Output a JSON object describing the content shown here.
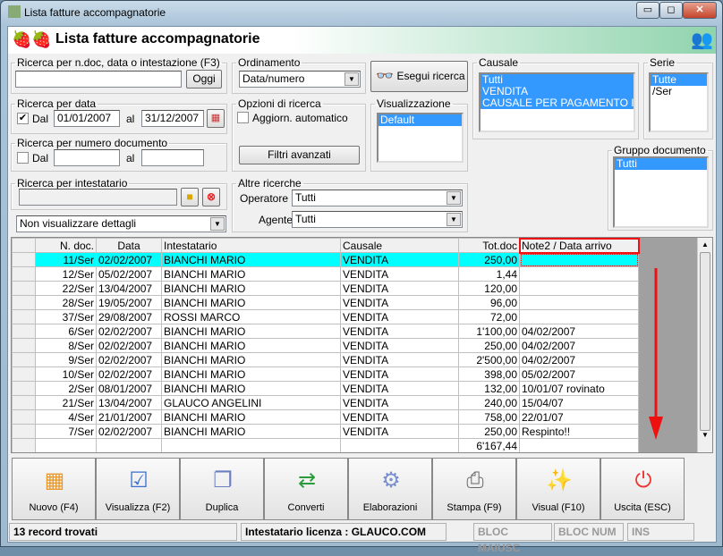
{
  "window": {
    "title": "Lista fatture accompagnatorie",
    "minimize": "▭",
    "maximize": "◻",
    "close": "✕"
  },
  "header": {
    "title": "Lista fatture accompagnatorie"
  },
  "search_text": {
    "legend": "Ricerca per n.doc, data o intestazione (F3)",
    "value": "",
    "today_button": "Oggi"
  },
  "ordering": {
    "legend": "Ordinamento",
    "value": "Data/numero"
  },
  "execute_button": "Esegui ricerca",
  "causale": {
    "legend": "Causale",
    "items": [
      "Tutti",
      "VENDITA",
      "CAUSALE PER PAGAMENTO IN C"
    ]
  },
  "serie": {
    "legend": "Serie",
    "items": [
      "Tutte",
      "/Ser"
    ]
  },
  "date_search": {
    "legend": "Ricerca per data",
    "checked": true,
    "from_label": "Dal",
    "from": "01/01/2007",
    "to_label": "al",
    "to": "31/12/2007"
  },
  "options": {
    "legend": "Opzioni di ricerca",
    "auto_update": "Aggiorn. automatico",
    "advanced_filters": "Filtri avanzati"
  },
  "view": {
    "legend": "Visualizzazione",
    "items": [
      "Default"
    ]
  },
  "doc_number": {
    "legend": "Ricerca per numero documento",
    "from_label": "Dal",
    "to_label": "al",
    "from": "",
    "to": ""
  },
  "gruppo": {
    "legend": "Gruppo documento",
    "items": [
      "Tutti"
    ]
  },
  "holder": {
    "legend": "Ricerca per intestatario",
    "value": ""
  },
  "other": {
    "legend": "Altre ricerche",
    "operator_label": "Operatore :",
    "operator": "Tutti",
    "agent_label": "Agente :",
    "agent": "Tutti"
  },
  "details": {
    "value": "Non visualizzare dettagli"
  },
  "grid": {
    "columns": [
      "N. doc.",
      "Data",
      "Intestatario",
      "Causale",
      "Tot.doc",
      "Note2 / Data arrivo"
    ],
    "rows": [
      [
        "11/Ser",
        "02/02/2007",
        "BIANCHI MARIO",
        "VENDITA",
        "250,00",
        ""
      ],
      [
        "12/Ser",
        "05/02/2007",
        "BIANCHI MARIO",
        "VENDITA",
        "1,44",
        ""
      ],
      [
        "22/Ser",
        "13/04/2007",
        "BIANCHI MARIO",
        "VENDITA",
        "120,00",
        ""
      ],
      [
        "28/Ser",
        "19/05/2007",
        "BIANCHI MARIO",
        "VENDITA",
        "96,00",
        ""
      ],
      [
        "37/Ser",
        "29/08/2007",
        "ROSSI MARCO",
        "VENDITA",
        "72,00",
        ""
      ],
      [
        "6/Ser",
        "02/02/2007",
        "BIANCHI MARIO",
        "VENDITA",
        "1'100,00",
        "04/02/2007"
      ],
      [
        "8/Ser",
        "02/02/2007",
        "BIANCHI MARIO",
        "VENDITA",
        "250,00",
        "04/02/2007"
      ],
      [
        "9/Ser",
        "02/02/2007",
        "BIANCHI MARIO",
        "VENDITA",
        "2'500,00",
        "04/02/2007"
      ],
      [
        "10/Ser",
        "02/02/2007",
        "BIANCHI MARIO",
        "VENDITA",
        "398,00",
        "05/02/2007"
      ],
      [
        "2/Ser",
        "08/01/2007",
        "BIANCHI MARIO",
        "VENDITA",
        "132,00",
        "10/01/07 rovinato"
      ],
      [
        "21/Ser",
        "13/04/2007",
        "GLAUCO ANGELINI",
        "VENDITA",
        "240,00",
        "15/04/07"
      ],
      [
        "4/Ser",
        "21/01/2007",
        "BIANCHI MARIO",
        "VENDITA",
        "758,00",
        "22/01/07"
      ],
      [
        "7/Ser",
        "02/02/2007",
        "BIANCHI MARIO",
        "VENDITA",
        "250,00",
        "Respinto!!"
      ]
    ],
    "total": "6'167,44"
  },
  "toolbar": [
    {
      "label": "Nuovo (F4)",
      "icon": "▦",
      "name": "new"
    },
    {
      "label": "Visualizza (F2)",
      "icon": "☑",
      "name": "view"
    },
    {
      "label": "Duplica",
      "icon": "❐",
      "name": "duplicate"
    },
    {
      "label": "Converti",
      "icon": "⇄",
      "name": "convert"
    },
    {
      "label": "Elaborazioni",
      "icon": "⚙",
      "name": "process"
    },
    {
      "label": "Stampa (F9)",
      "icon": "⎙",
      "name": "print"
    },
    {
      "label": "Visual (F10)",
      "icon": "✨",
      "name": "visual"
    },
    {
      "label": "Uscita (ESC)",
      "icon": "⏻",
      "name": "exit"
    }
  ],
  "status": {
    "records": "13 record trovati",
    "license": "Intestatario licenza : GLAUCO.COM",
    "caps": "BLOC MAIUSC",
    "num": "BLOC NUM",
    "ins": "INS"
  }
}
